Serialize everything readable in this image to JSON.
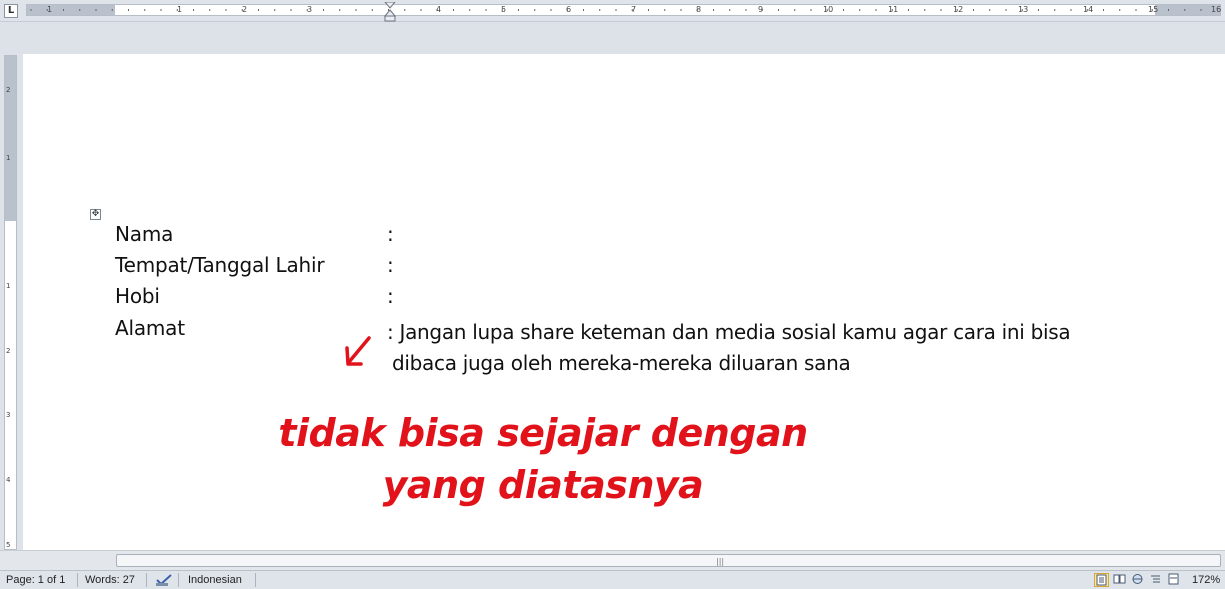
{
  "ruler": {
    "corner_icon": "tab-stop-left-icon",
    "labels": [
      "1",
      "1",
      "2",
      "3",
      "4",
      "5",
      "6",
      "7",
      "8",
      "9",
      "10",
      "11",
      "12",
      "13",
      "14",
      "15",
      "16",
      "17"
    ],
    "vertical_labels": [
      "2",
      "1",
      "1",
      "2",
      "3",
      "4",
      "5"
    ]
  },
  "document": {
    "table_handle_icon": "table-move-handle-icon",
    "rows": [
      {
        "label": "Nama",
        "colon": ":"
      },
      {
        "label": "Tempat/Tanggal Lahir",
        "colon": ":"
      },
      {
        "label": "Hobi",
        "colon": ":"
      },
      {
        "label": "Alamat",
        "colon": ":"
      }
    ],
    "address_line1": ": Jangan lupa share keteman dan media sosial kamu agar cara ini bisa",
    "address_line2": "dibaca juga oleh mereka-mereka diluaran sana",
    "annotation_line1": "tidak bisa sejajar dengan",
    "annotation_line2": "yang diatasnya",
    "arrow_icon": "red-arrow-down-left-icon",
    "annotation_color": "#e2121b"
  },
  "status_bar": {
    "page": "Page: 1 of 1",
    "words": "Words: 27",
    "proofing_icon": "proofing-check-icon",
    "language": "Indonesian",
    "zoom": "172%",
    "view_icons": [
      "print-layout-icon",
      "full-screen-reading-icon",
      "web-layout-icon",
      "outline-icon",
      "draft-icon"
    ]
  }
}
